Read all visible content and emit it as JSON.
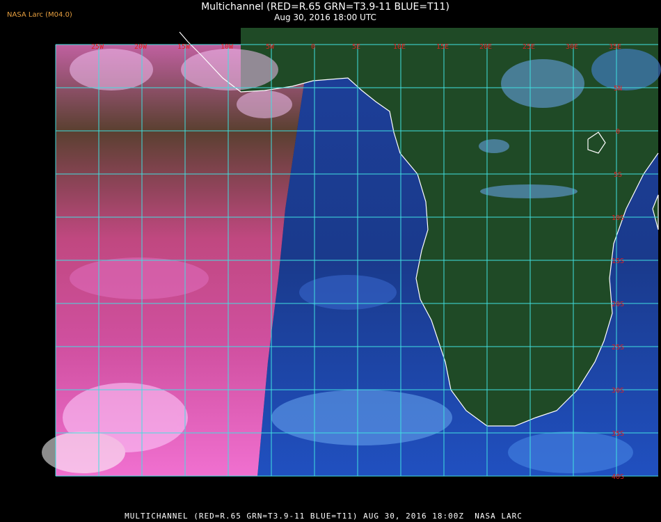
{
  "header": {
    "badge": "NASA Larc (M04.0)",
    "title": "Multichannel (RED=R.65 GRN=T3.9-11 BLUE=T11)",
    "subtitle": "Aug 30, 2016 18:00 UTC"
  },
  "map": {
    "lon_labels": [
      "25W",
      "20W",
      "15W",
      "10W",
      "5W",
      "0",
      "5E",
      "10E",
      "15E",
      "20E",
      "25E",
      "30E",
      "35E"
    ],
    "lat_labels": [
      "5N",
      "0",
      "5S",
      "10S",
      "15S",
      "20S",
      "25S",
      "30S",
      "35S",
      "40S"
    ],
    "colors": {
      "grid": "#40e0e0",
      "label": "#e02020",
      "coast": "#ffffff",
      "land": "#1f4a26",
      "ocean": "#1a3a8c",
      "west_cloud": "#e060b0",
      "east_cloud": "#4a8ae8"
    }
  },
  "caption": "MULTICHANNEL (RED=R.65 GRN=T3.9-11 BLUE=T11) AUG 30, 2016 18:00Z  NASA LARC"
}
